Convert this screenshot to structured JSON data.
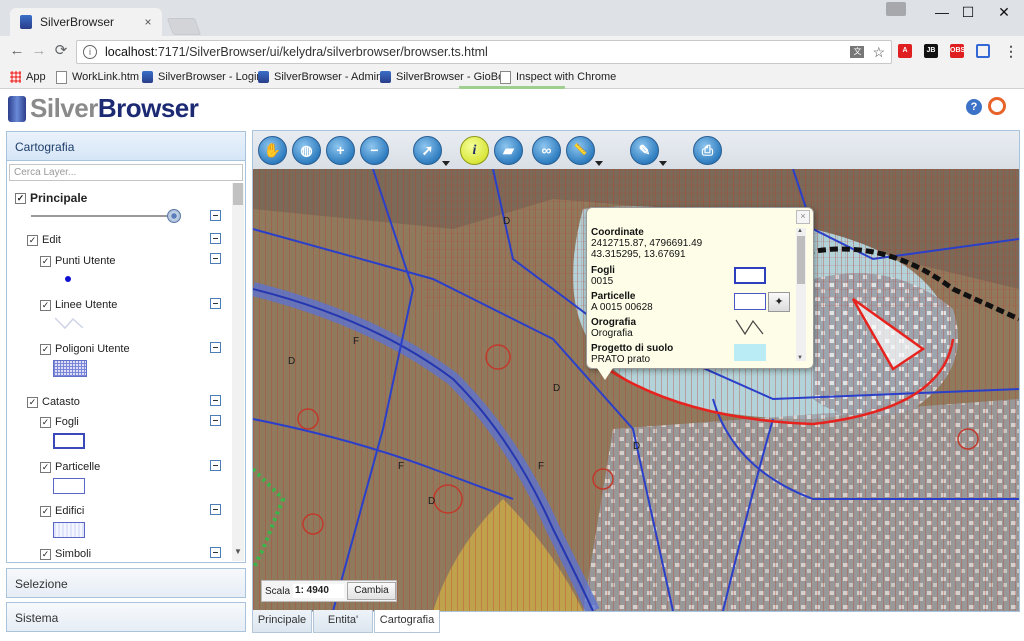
{
  "browser": {
    "tab_title": "SilverBrowser",
    "tab_close": "×",
    "window_controls": [
      "—",
      "☐",
      "✕"
    ],
    "nav": {
      "back": "←",
      "forward": "→",
      "reload": "⟳"
    },
    "url_host": "localhost",
    "url_rest": ":7171/SilverBrowser/ui/kelydra/silverbrowser/browser.ts.html",
    "star": "☆",
    "extensions": [
      {
        "label": "A",
        "color": "#e02020"
      },
      {
        "label": "JB",
        "color": "#111111"
      },
      {
        "label": "OBS",
        "color": "#e02020"
      },
      {
        "label": "[ ]",
        "color": "#3367d6"
      },
      {
        "label": "⋮",
        "color": "#666666"
      }
    ],
    "bookmarks": [
      {
        "label": "App",
        "icon": "apps-grid-icon"
      },
      {
        "label": "WorkLink.htm",
        "icon": "page-icon"
      },
      {
        "label": "SilverBrowser - Login",
        "icon": "silverbrowser-icon"
      },
      {
        "label": "SilverBrowser - Admin",
        "icon": "silverbrowser-icon"
      },
      {
        "label": "SilverBrowser - GioBo",
        "icon": "silverbrowser-icon"
      },
      {
        "label": "Inspect with Chrome",
        "icon": "page-icon"
      }
    ]
  },
  "app": {
    "logo_silver": "Silver",
    "logo_browser": "Browser",
    "help_label": "?"
  },
  "sidebar": {
    "sections": [
      "Cartografia",
      "Selezione",
      "Sistema"
    ],
    "search_placeholder": "Cerca Layer...",
    "layers": {
      "principale": "Principale",
      "edit": "Edit",
      "punti": "Punti Utente",
      "linee": "Linee Utente",
      "poligoni": "Poligoni Utente",
      "catasto": "Catasto",
      "fogli": "Fogli",
      "particelle": "Particelle",
      "edifici": "Edifici",
      "simboli": "Simboli"
    },
    "opacity_value": 0.92
  },
  "map": {
    "tools": [
      {
        "name": "pan-tool",
        "glyph": "✋"
      },
      {
        "name": "globe-tool",
        "glyph": "◍"
      },
      {
        "name": "zoom-in-tool",
        "glyph": "+"
      },
      {
        "name": "zoom-out-tool",
        "glyph": "−"
      },
      {
        "name": "select-tool",
        "glyph": "➚"
      },
      {
        "name": "info-tool",
        "glyph": "i"
      },
      {
        "name": "erase-tool",
        "glyph": "▰"
      },
      {
        "name": "binoculars-tool",
        "glyph": "∞"
      },
      {
        "name": "measure-tool",
        "glyph": "📏"
      },
      {
        "name": "draw-tool",
        "glyph": "✎"
      },
      {
        "name": "print-tool",
        "glyph": "⎙"
      }
    ],
    "scale_label": "Scala",
    "scale_value": "1: 4940",
    "scale_button": "Cambia"
  },
  "popup": {
    "close": "×",
    "coord_title": "Coordinate",
    "coord_xy": "2412715.87, 4796691.49",
    "coord_latlon": "43.315295, 13.67691",
    "fogli_title": "Fogli",
    "fogli_value": "0015",
    "particelle_title": "Particelle",
    "particelle_value": "A 0015 00628",
    "orografia_title": "Orografia",
    "orografia_value": "Orografia",
    "progetto_title": "Progetto di suolo",
    "progetto_value": "PRATO prato"
  },
  "bottom_tabs": [
    "Principale",
    "Entita'",
    "Cartografia"
  ],
  "colors": {
    "accent": "#1c2a74",
    "panel_border": "#aac3dd",
    "map_hatch": "#c0392b",
    "map_lines": "#2b3fc9"
  }
}
